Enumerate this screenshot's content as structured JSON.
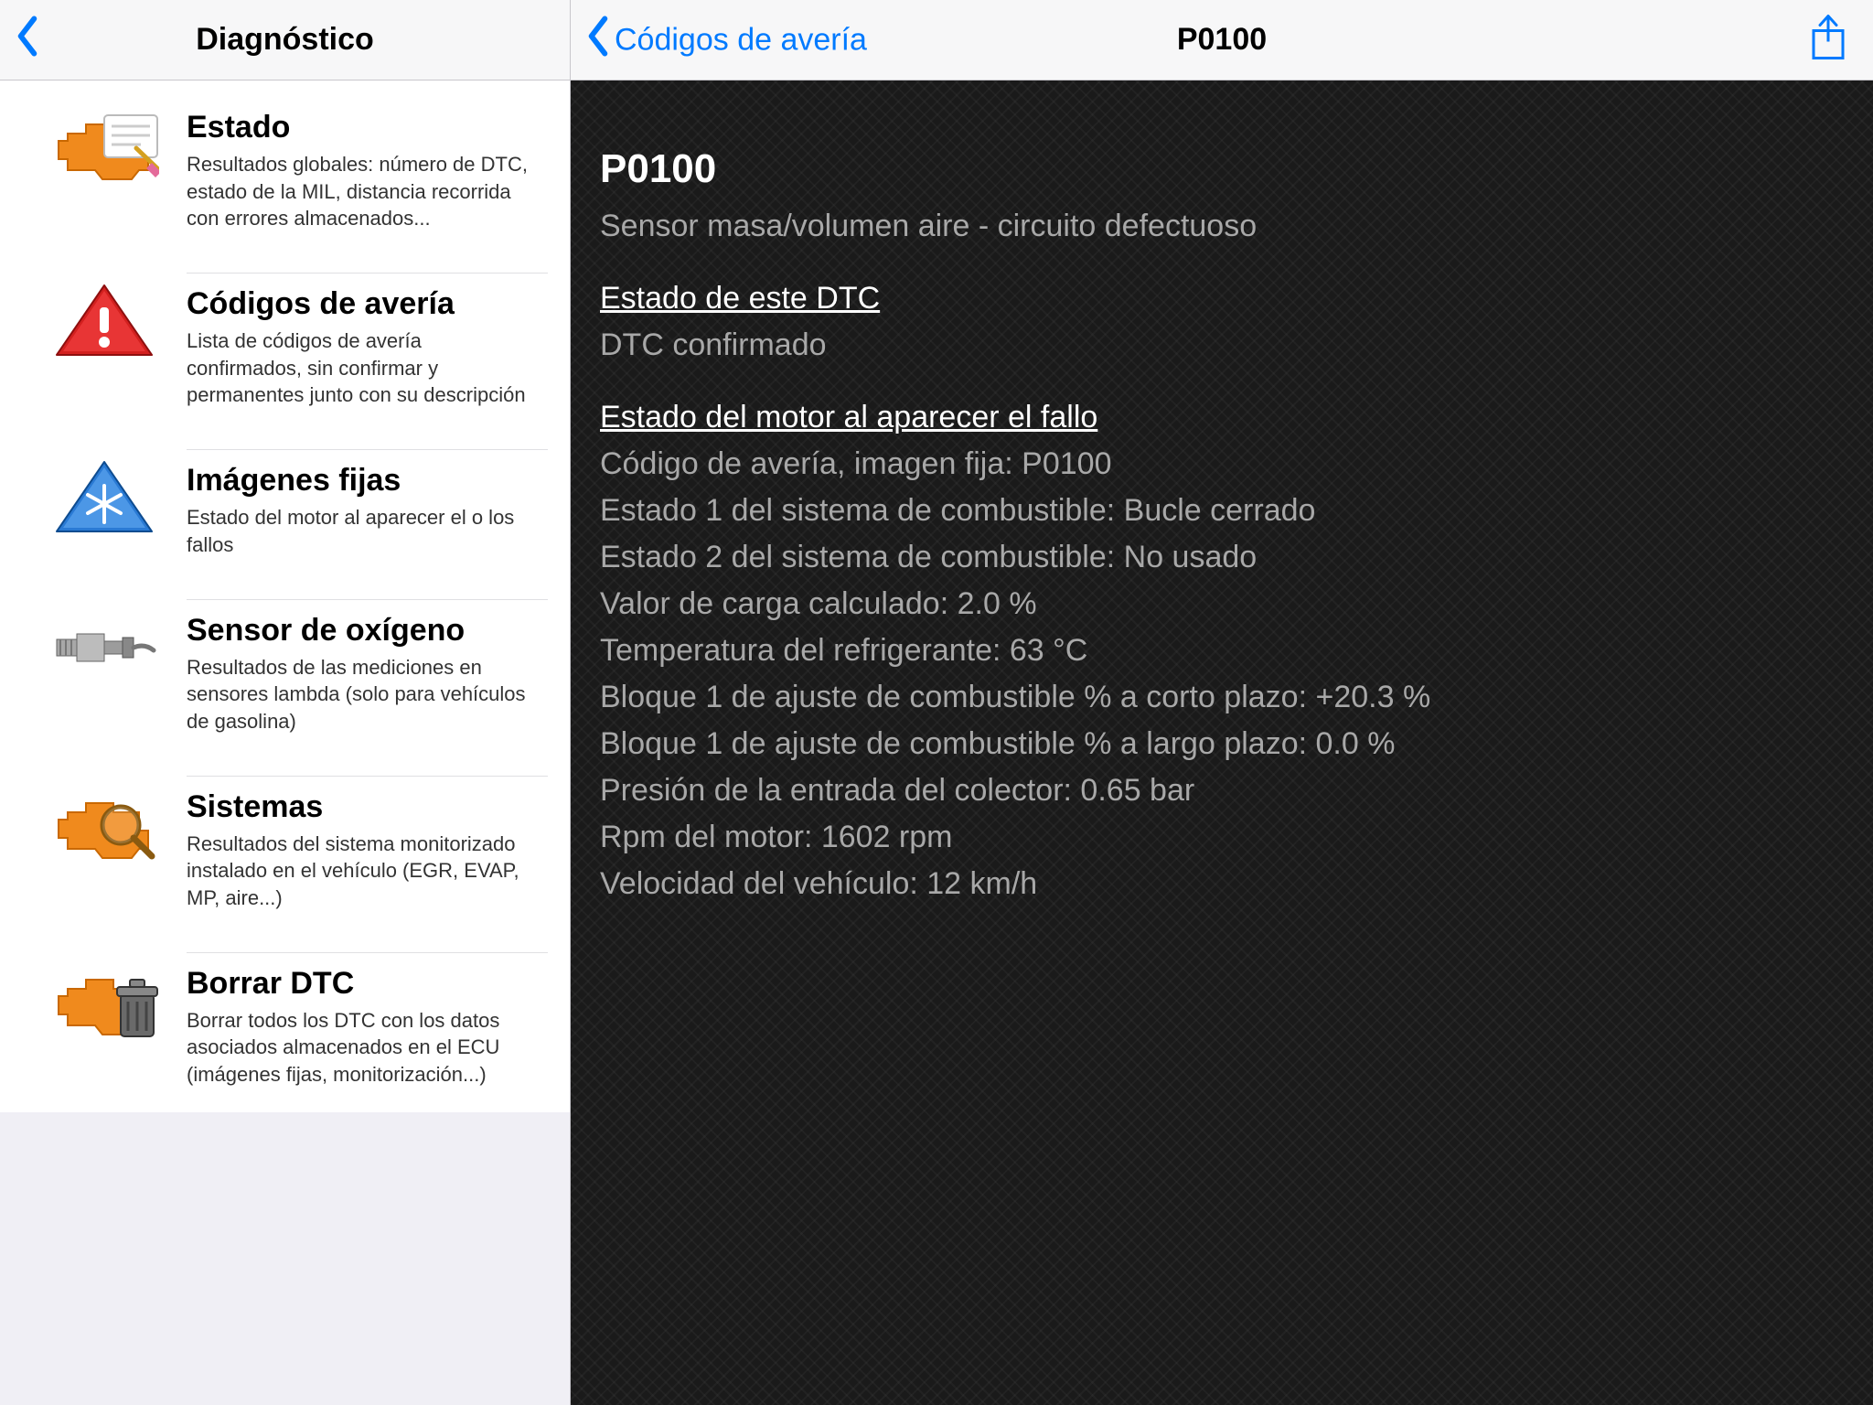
{
  "sidebar": {
    "title": "Diagnóstico",
    "items": [
      {
        "icon": "engine-notes-icon",
        "title": "Estado",
        "desc": "Resultados globales: número de DTC, estado de la MIL, distancia recorrida con errores almacenados..."
      },
      {
        "icon": "warning-triangle-icon",
        "title": "Códigos de avería",
        "desc": "Lista de códigos de avería confirmados, sin confirmar y permanentes junto con su descripción"
      },
      {
        "icon": "freeze-frame-icon",
        "title": "Imágenes fijas",
        "desc": "Estado del motor al aparecer el o los fallos"
      },
      {
        "icon": "oxygen-sensor-icon",
        "title": "Sensor de oxígeno",
        "desc": "Resultados de las mediciones en sensores lambda (solo para vehículos de gasolina)"
      },
      {
        "icon": "systems-icon",
        "title": "Sistemas",
        "desc": "Resultados del sistema monitorizado instalado en el vehículo (EGR, EVAP, MP, aire...)"
      },
      {
        "icon": "clear-dtc-icon",
        "title": "Borrar DTC",
        "desc": "Borrar todos los DTC con los datos asociados almacenados en el ECU (imágenes fijas, monitorización...)"
      }
    ]
  },
  "detail": {
    "back_label": "Códigos de avería",
    "title": "P0100",
    "code": "P0100",
    "description": "Sensor masa/volumen aire - circuito defectuoso",
    "status_section_title": "Estado de este DTC",
    "status_value": "DTC confirmado",
    "engine_section_title": "Estado del motor al aparecer el fallo",
    "engine_lines": [
      "Código de avería, imagen fija: P0100",
      "Estado 1 del sistema de combustible: Bucle cerrado",
      "Estado 2 del sistema de combustible: No usado",
      "Valor de carga calculado: 2.0 %",
      "Temperatura del refrigerante: 63 °C",
      "Bloque 1 de ajuste de combustible % a corto plazo: +20.3 %",
      "Bloque 1 de ajuste de combustible % a largo plazo: 0.0 %",
      "Presión de la entrada del colector: 0.65 bar",
      "Rpm del motor: 1602 rpm",
      "Velocidad del vehículo: 12 km/h"
    ]
  }
}
